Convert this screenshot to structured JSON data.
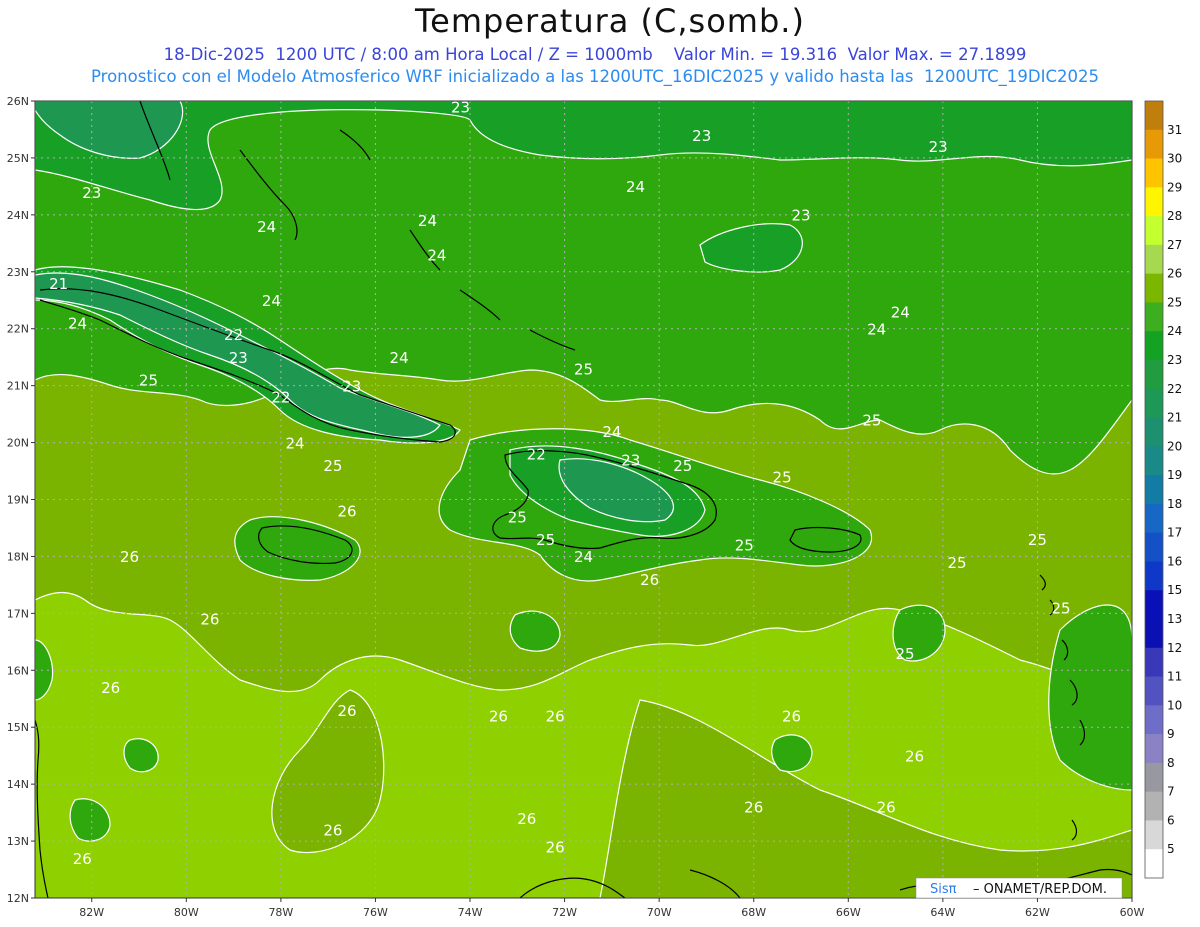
{
  "title": "Temperatura (C,somb.)",
  "subtitle_line1": "18-Dic-2025  1200 UTC / 8:00 am Hora Local / Z = 1000mb    Valor Min. = 19.316  Valor Max. = 27.1899",
  "subtitle_line2": "Pronostico con el Modelo Atmosferico WRF inicializado a las 1200UTC_16DIC2025 y valido hasta las  1200UTC_19DIC2025",
  "map": {
    "lat_labels": [
      "26N",
      "25N",
      "24N",
      "23N",
      "22N",
      "21N",
      "20N",
      "19N",
      "18N",
      "17N",
      "16N",
      "15N",
      "14N",
      "13N",
      "12N"
    ],
    "lon_labels": [
      "82W",
      "80W",
      "78W",
      "76W",
      "74W",
      "72W",
      "70W",
      "68W",
      "66W",
      "64W",
      "62W",
      "60W"
    ],
    "contour_labels": [
      {
        "text": "23",
        "lon": -74.2,
        "lat": 25.8
      },
      {
        "text": "23",
        "lon": -69.1,
        "lat": 25.3
      },
      {
        "text": "23",
        "lon": -64.1,
        "lat": 25.1
      },
      {
        "text": "24",
        "lon": -70.5,
        "lat": 24.4
      },
      {
        "text": "23",
        "lon": -82.0,
        "lat": 24.3
      },
      {
        "text": "23",
        "lon": -67.0,
        "lat": 23.9
      },
      {
        "text": "24",
        "lon": -74.9,
        "lat": 23.8
      },
      {
        "text": "24",
        "lon": -78.3,
        "lat": 23.7
      },
      {
        "text": "24",
        "lon": -74.7,
        "lat": 23.2
      },
      {
        "text": "21",
        "lon": -82.7,
        "lat": 22.7
      },
      {
        "text": "24",
        "lon": -78.2,
        "lat": 22.4
      },
      {
        "text": "24",
        "lon": -82.3,
        "lat": 22.0
      },
      {
        "text": "22",
        "lon": -79.0,
        "lat": 21.8
      },
      {
        "text": "24",
        "lon": -64.9,
        "lat": 22.2
      },
      {
        "text": "24",
        "lon": -65.4,
        "lat": 21.9
      },
      {
        "text": "23",
        "lon": -78.9,
        "lat": 21.4
      },
      {
        "text": "24",
        "lon": -75.5,
        "lat": 21.4
      },
      {
        "text": "25",
        "lon": -71.6,
        "lat": 21.2
      },
      {
        "text": "25",
        "lon": -80.8,
        "lat": 21.0
      },
      {
        "text": "23",
        "lon": -76.5,
        "lat": 20.9
      },
      {
        "text": "22",
        "lon": -78.0,
        "lat": 20.7
      },
      {
        "text": "24",
        "lon": -71.0,
        "lat": 20.1
      },
      {
        "text": "25",
        "lon": -65.5,
        "lat": 20.3
      },
      {
        "text": "24",
        "lon": -77.7,
        "lat": 19.9
      },
      {
        "text": "22",
        "lon": -72.6,
        "lat": 19.7
      },
      {
        "text": "23",
        "lon": -70.6,
        "lat": 19.6
      },
      {
        "text": "25",
        "lon": -69.5,
        "lat": 19.5
      },
      {
        "text": "25",
        "lon": -76.9,
        "lat": 19.5
      },
      {
        "text": "25",
        "lon": -67.4,
        "lat": 19.3
      },
      {
        "text": "26",
        "lon": -76.6,
        "lat": 18.7
      },
      {
        "text": "25",
        "lon": -73.0,
        "lat": 18.6
      },
      {
        "text": "25",
        "lon": -72.4,
        "lat": 18.2
      },
      {
        "text": "25",
        "lon": -68.2,
        "lat": 18.1
      },
      {
        "text": "24",
        "lon": -71.6,
        "lat": 17.9
      },
      {
        "text": "26",
        "lon": -81.2,
        "lat": 17.9
      },
      {
        "text": "25",
        "lon": -63.7,
        "lat": 17.8
      },
      {
        "text": "25",
        "lon": -62.0,
        "lat": 18.2
      },
      {
        "text": "26",
        "lon": -70.2,
        "lat": 17.5
      },
      {
        "text": "26",
        "lon": -79.5,
        "lat": 16.8
      },
      {
        "text": "25",
        "lon": -61.5,
        "lat": 17.0
      },
      {
        "text": "25",
        "lon": -64.8,
        "lat": 16.2
      },
      {
        "text": "26",
        "lon": -81.6,
        "lat": 15.6
      },
      {
        "text": "26",
        "lon": -76.6,
        "lat": 15.2
      },
      {
        "text": "26",
        "lon": -73.4,
        "lat": 15.1
      },
      {
        "text": "26",
        "lon": -72.2,
        "lat": 15.1
      },
      {
        "text": "26",
        "lon": -67.2,
        "lat": 15.1
      },
      {
        "text": "26",
        "lon": -64.6,
        "lat": 14.4
      },
      {
        "text": "26",
        "lon": -68.0,
        "lat": 13.5
      },
      {
        "text": "26",
        "lon": -65.2,
        "lat": 13.5
      },
      {
        "text": "26",
        "lon": -76.9,
        "lat": 13.1
      },
      {
        "text": "26",
        "lon": -72.8,
        "lat": 13.3
      },
      {
        "text": "26",
        "lon": -72.2,
        "lat": 12.8
      },
      {
        "text": "26",
        "lon": -82.2,
        "lat": 12.6
      }
    ]
  },
  "colorbar": {
    "labels": [
      "31",
      "30",
      "29",
      "28",
      "27",
      "26",
      "25",
      "24",
      "23",
      "22",
      "21",
      "20",
      "19",
      "18",
      "17",
      "16",
      "15",
      "13",
      "12",
      "11",
      "10",
      "9",
      "8",
      "7",
      "6",
      "5"
    ],
    "colors": [
      "#c07e0c",
      "#e89a06",
      "#ffc400",
      "#fff500",
      "#c4ff30",
      "#a6d850",
      "#7cb700",
      "#3cae1f",
      "#14a222",
      "#219c40",
      "#1e9856",
      "#1c906f",
      "#198a88",
      "#137ca4",
      "#1668c4",
      "#1450c6",
      "#1038c8",
      "#0a10b8",
      "#0a10b2",
      "#3838b8",
      "#5252c0",
      "#6e6ec8",
      "#8a82c4",
      "#9898a0",
      "#b2b2b2",
      "#d8d8d8",
      "#ffffff"
    ]
  },
  "credit": {
    "brand": "Sisπ",
    "text": "– ONAMET/REP.DOM."
  }
}
